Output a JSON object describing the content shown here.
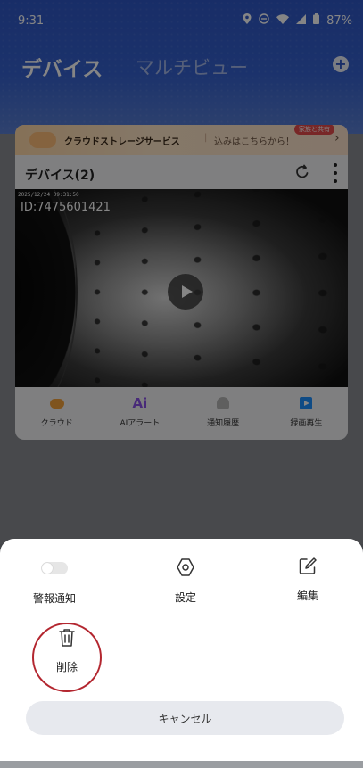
{
  "status_bar": {
    "time": "9:31",
    "battery": "87%",
    "icons": [
      "location-icon",
      "dnd-icon",
      "wifi-icon",
      "signal-icon",
      "battery-icon"
    ]
  },
  "header": {
    "title": "デバイス",
    "subtitle_tab": "マルチビュー",
    "add_icon": "plus-circle-icon"
  },
  "banner": {
    "text": "クラウドストレージサービス",
    "separator": "|",
    "subtext": "込みはこちらから！",
    "badge": "家族と共有",
    "arrow": "›"
  },
  "device_card": {
    "title": "デバイス(2)",
    "timestamp": "2025/12/24 09:31:50",
    "device_id": "ID:7475601421",
    "actions": [
      {
        "label": "クラウド",
        "icon": "cloud-icon"
      },
      {
        "label": "AIアラート",
        "icon": "ai-icon"
      },
      {
        "label": "通知履歴",
        "icon": "bell-icon"
      },
      {
        "label": "録画再生",
        "icon": "playback-icon"
      }
    ]
  },
  "sheet": {
    "items": [
      {
        "label": "警報通知",
        "icon": "toggle-icon",
        "toggle_on": false
      },
      {
        "label": "設定",
        "icon": "hexagon-settings-icon"
      },
      {
        "label": "編集",
        "icon": "edit-icon"
      },
      {
        "label": "削除",
        "icon": "trash-icon"
      }
    ],
    "cancel_label": "キャンセル",
    "highlight_color": "#b3262f"
  },
  "colors": {
    "header_blue": "#2f57c6",
    "cloud_orange": "#f3a23b",
    "ai_purple": "#8a52e8",
    "playback_blue": "#1e90ff",
    "badge_red": "#e74b4b"
  }
}
